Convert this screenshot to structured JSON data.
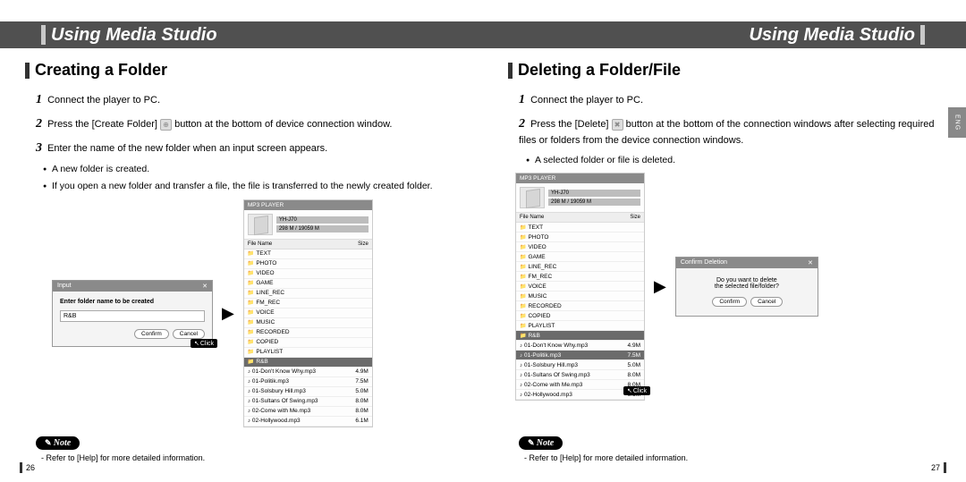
{
  "header": {
    "title_left": "Using Media Studio",
    "title_right": "Using Media Studio"
  },
  "side_tab": "ENG",
  "left_page": {
    "section_title": "Creating a Folder",
    "steps": {
      "s1": "Connect the player to PC.",
      "s2a": "Press the [Create Folder]",
      "s2b": "button at the bottom of device connection window.",
      "s3": "Enter the name of the new folder when an input screen appears."
    },
    "bullets": {
      "b1": "A new folder is created.",
      "b2": "If you open a new folder and transfer a file, the file is transferred to the newly created folder."
    },
    "input_dialog": {
      "title": "Input",
      "label": "Enter folder name to be created",
      "value": "R&B",
      "confirm": "Confirm",
      "cancel": "Cancel"
    },
    "click_label": "Click",
    "note_label": "Note",
    "note_text": "Refer to [Help] for more detailed information.",
    "page_number": "26"
  },
  "right_page": {
    "section_title": "Deleting a Folder/File",
    "steps": {
      "s1": "Connect the player to PC.",
      "s2a": "Press the [Delete]",
      "s2b": "button at the bottom of the connection windows after selecting required files or folders from the device connection windows."
    },
    "bullets": {
      "b1": "A selected folder or file is deleted."
    },
    "confirm_dialog": {
      "title": "Confirm Deletion",
      "line1": "Do you want to delete",
      "line2": "the selected file/folder?",
      "confirm": "Confirm",
      "cancel": "Cancel"
    },
    "click_label": "Click",
    "note_label": "Note",
    "note_text": "Refer to [Help] for more detailed information.",
    "page_number": "27"
  },
  "player_panel": {
    "title": "MP3 PLAYER",
    "device": "YH-J70",
    "capacity": "298 M / 19059 M",
    "col_name": "File Name",
    "col_size": "Size",
    "folders": [
      "TEXT",
      "PHOTO",
      "VIDEO",
      "GAME",
      "LINE_REC",
      "FM_REC",
      "VOICE",
      "MUSIC",
      "RECORDED",
      "COPIED",
      "PLAYLIST"
    ],
    "new_folder": "R&B",
    "files": [
      {
        "name": "01-Don't Know Why.mp3",
        "size": "4.9M"
      },
      {
        "name": "01-Politik.mp3",
        "size": "7.5M"
      },
      {
        "name": "01-Solsbury Hill.mp3",
        "size": "5.0M"
      },
      {
        "name": "01-Sultans Of Swing.mp3",
        "size": "8.0M"
      },
      {
        "name": "02-Come with Me.mp3",
        "size": "8.0M"
      },
      {
        "name": "02-Hollywood.mp3",
        "size": "6.1M"
      }
    ]
  }
}
